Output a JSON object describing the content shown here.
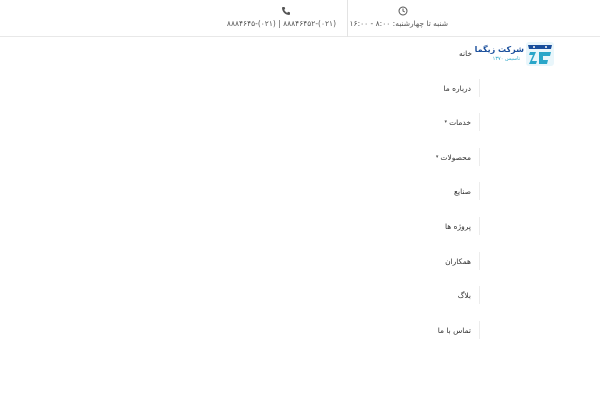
{
  "topbar": {
    "hours": {
      "icon": "clock-icon",
      "text": "شنبه تا چهارشنبه: ۸:۰۰ - ۱۶:۰۰"
    },
    "phones": {
      "icon": "phone-icon",
      "text": "(۰۲۱)-۸۸۸۴۶۴۵۲ | (۰۲۱)-۸۸۸۴۶۴۵"
    }
  },
  "logo": {
    "name": "شرکت زیگما",
    "subtitle": "تاسیس ۱۳۷۰",
    "icon": "zigma-logo-icon"
  },
  "nav": {
    "items": [
      {
        "label": "خانه",
        "has_dropdown": false
      },
      {
        "label": "درباره ما",
        "has_dropdown": false
      },
      {
        "label": "خدمات",
        "has_dropdown": true
      },
      {
        "label": "محصولات",
        "has_dropdown": true
      },
      {
        "label": "صنایع",
        "has_dropdown": false
      },
      {
        "label": "پروژه ها",
        "has_dropdown": false
      },
      {
        "label": "همکاران",
        "has_dropdown": false
      },
      {
        "label": "بلاگ",
        "has_dropdown": false
      },
      {
        "label": "تماس با ما",
        "has_dropdown": false
      }
    ]
  },
  "colors": {
    "brand": "#1a4f9c",
    "accent": "#2aa6c9",
    "border": "#e8e8e8"
  }
}
